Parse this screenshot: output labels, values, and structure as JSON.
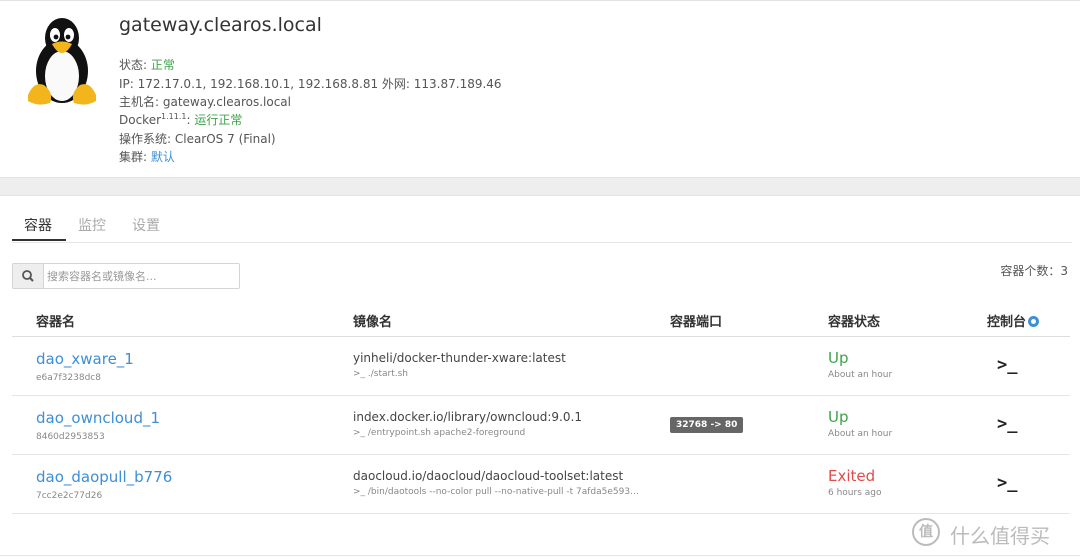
{
  "host": {
    "title": "gateway.clearos.local",
    "status_label": "状态: ",
    "status_value": "正常",
    "ip_line": "IP: 172.17.0.1, 192.168.10.1, 192.168.8.81 外网: 113.87.189.46",
    "hostname_line": "主机名: gateway.clearos.local",
    "docker_label": "Docker",
    "docker_version": "1.11.1",
    "docker_sep": ": ",
    "docker_status": "运行正常",
    "os_line": "操作系统: ClearOS 7 (Final)",
    "cluster_label": "集群: ",
    "cluster_value": "默认"
  },
  "tabs": [
    {
      "label": "容器",
      "active": true
    },
    {
      "label": "监控",
      "active": false
    },
    {
      "label": "设置",
      "active": false
    }
  ],
  "search": {
    "placeholder": "搜索容器名或镜像名...",
    "icon": "search-icon"
  },
  "container_count": "容器个数：3",
  "table": {
    "headers": {
      "name": "容器名",
      "image": "镜像名",
      "port": "容器端口",
      "status": "容器状态",
      "console": "控制台"
    },
    "rows": [
      {
        "name": "dao_xware_1",
        "id": "e6a7f3238dc8",
        "image": "yinheli/docker-thunder-xware:latest",
        "cmd": ">_ ./start.sh",
        "port": "",
        "status": "Up",
        "since": "About an hour",
        "console_glyph": ">_"
      },
      {
        "name": "dao_owncloud_1",
        "id": "8460d2953853",
        "image": "index.docker.io/library/owncloud:9.0.1",
        "cmd": ">_ /entrypoint.sh apache2-foreground",
        "port": "32768 -> 80",
        "status": "Up",
        "since": "About an hour",
        "console_glyph": ">_"
      },
      {
        "name": "dao_daopull_b776",
        "id": "7cc2e2c77d26",
        "image": "daocloud.io/daocloud/daocloud-toolset:latest",
        "cmd": ">_ /bin/daotools --no-color pull --no-native-pull -t 7afda5e593...",
        "port": "",
        "status": "Exited",
        "since": "6 hours ago",
        "console_glyph": ">_"
      }
    ]
  },
  "watermark": {
    "badge": "值",
    "text": "什么值得买"
  },
  "colors": {
    "ok_green": "#3ea34a",
    "link_blue": "#3d8fd6",
    "error_red": "#e24b4b"
  }
}
